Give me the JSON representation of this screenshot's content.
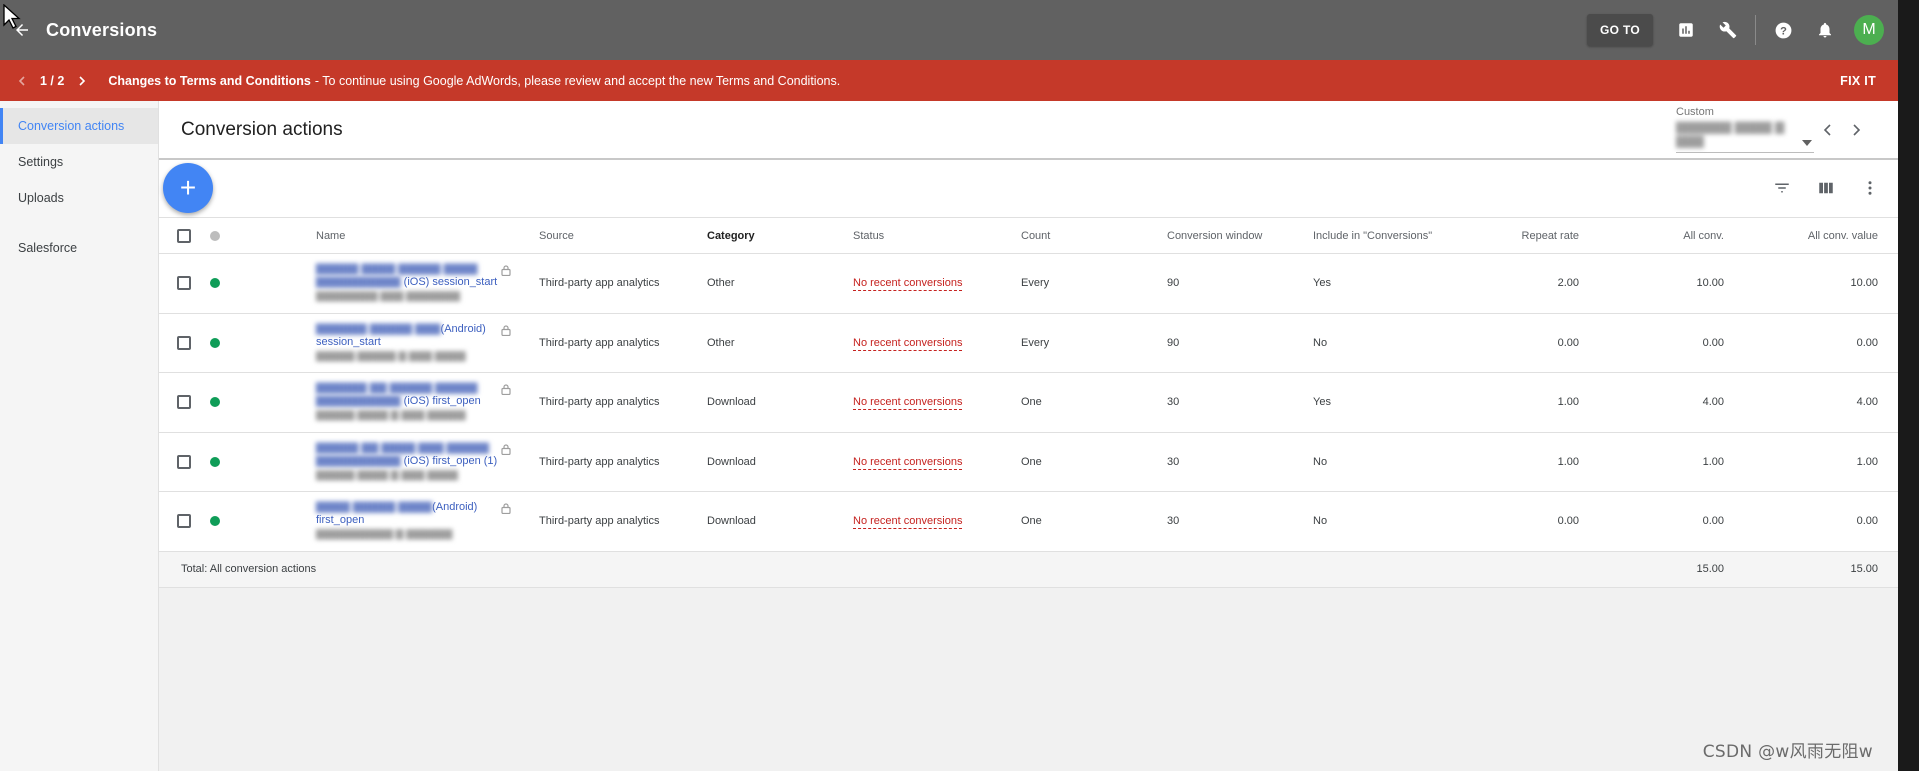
{
  "app": {
    "title": "Conversions"
  },
  "topbar": {
    "goto_label": "GO TO",
    "avatar_initial": "M",
    "icons": [
      "back-arrow-icon",
      "reports-icon",
      "wrench-icon",
      "help-icon",
      "bell-icon"
    ]
  },
  "banner": {
    "pager": "1 / 2",
    "title": "Changes to Terms and Conditions",
    "message": " - To continue using Google AdWords, please review and accept the new Terms and Conditions.",
    "action": "FIX IT"
  },
  "sidebar": {
    "items": [
      {
        "label": "Conversion actions",
        "active": true
      },
      {
        "label": "Settings",
        "active": false
      },
      {
        "label": "Uploads",
        "active": false
      },
      {
        "label": "Salesforce",
        "active": false
      }
    ]
  },
  "main": {
    "title": "Conversion actions",
    "date_range": {
      "label": "Custom"
    },
    "add_button": "+"
  },
  "table": {
    "headers": {
      "name": "Name",
      "source": "Source",
      "category": "Category",
      "status": "Status",
      "count": "Count",
      "window": "Conversion window",
      "include": "Include in \"Conversions\"",
      "repeat": "Repeat rate",
      "all_conv": "All conv.",
      "all_conv_value": "All conv. value"
    },
    "rows": [
      {
        "name_visible": "(iOS) session_start",
        "name_line2": "",
        "source": "Third-party app analytics",
        "category": "Other",
        "status": "No recent conversions",
        "count": "Every",
        "window": "90",
        "include": "Yes",
        "repeat": "2.00",
        "all_conv": "10.00",
        "all_conv_value": "10.00"
      },
      {
        "name_visible": "(Android)",
        "name_line2": "session_start",
        "source": "Third-party app analytics",
        "category": "Other",
        "status": "No recent conversions",
        "count": "Every",
        "window": "90",
        "include": "No",
        "repeat": "0.00",
        "all_conv": "0.00",
        "all_conv_value": "0.00"
      },
      {
        "name_visible": "(iOS) first_open",
        "name_line2": "",
        "source": "Third-party app analytics",
        "category": "Download",
        "status": "No recent conversions",
        "count": "One",
        "window": "30",
        "include": "Yes",
        "repeat": "1.00",
        "all_conv": "4.00",
        "all_conv_value": "4.00"
      },
      {
        "name_visible": "(iOS) first_open (1)",
        "name_line2": "",
        "source": "Third-party app analytics",
        "category": "Download",
        "status": "No recent conversions",
        "count": "One",
        "window": "30",
        "include": "No",
        "repeat": "1.00",
        "all_conv": "1.00",
        "all_conv_value": "1.00"
      },
      {
        "name_visible": "(Android)",
        "name_line2": "first_open",
        "source": "Third-party app analytics",
        "category": "Download",
        "status": "No recent conversions",
        "count": "One",
        "window": "30",
        "include": "No",
        "repeat": "0.00",
        "all_conv": "0.00",
        "all_conv_value": "0.00"
      }
    ],
    "total": {
      "label": "Total: All conversion actions",
      "all_conv": "15.00",
      "all_conv_value": "15.00"
    }
  },
  "watermark": "CSDN @w风雨无阻w",
  "colors": {
    "topbar": "#616161",
    "banner": "#c53929",
    "accent": "#4285f4",
    "status_red": "#c5221f",
    "enabled_green": "#0f9d58"
  }
}
